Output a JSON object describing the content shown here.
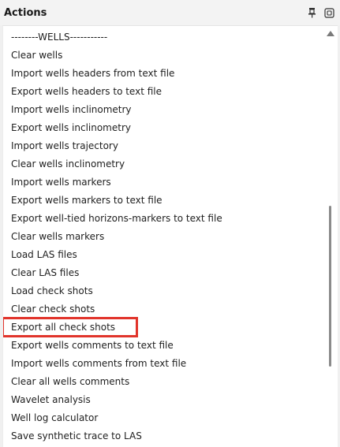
{
  "panel": {
    "title": "Actions",
    "icons": [
      "pin-icon",
      "float-window-icon"
    ]
  },
  "actions": {
    "items": [
      "--------WELLS-----------",
      "Clear wells",
      "Import wells headers from text file",
      "Export wells headers to text file",
      "Import wells inclinometry",
      "Export wells inclinometry",
      "Import wells trajectory",
      "Clear wells inclinometry",
      "Import wells markers",
      "Export wells markers to text file",
      "Export well-tied horizons-markers to text file",
      "Clear wells markers",
      "Load LAS files",
      "Clear LAS files",
      "Load check shots",
      "Clear check shots",
      "Export all check shots",
      "Export wells comments to text file",
      "Import wells comments from text file",
      "Clear all wells comments",
      "Wavelet analysis",
      "Well log calculator",
      "Save synthetic trace to LAS"
    ],
    "highlighted_item": "Export all check shots"
  },
  "colors": {
    "highlight_border": "#e1342b",
    "list_background": "#ffffff",
    "header_background": "#f3f3f3"
  }
}
